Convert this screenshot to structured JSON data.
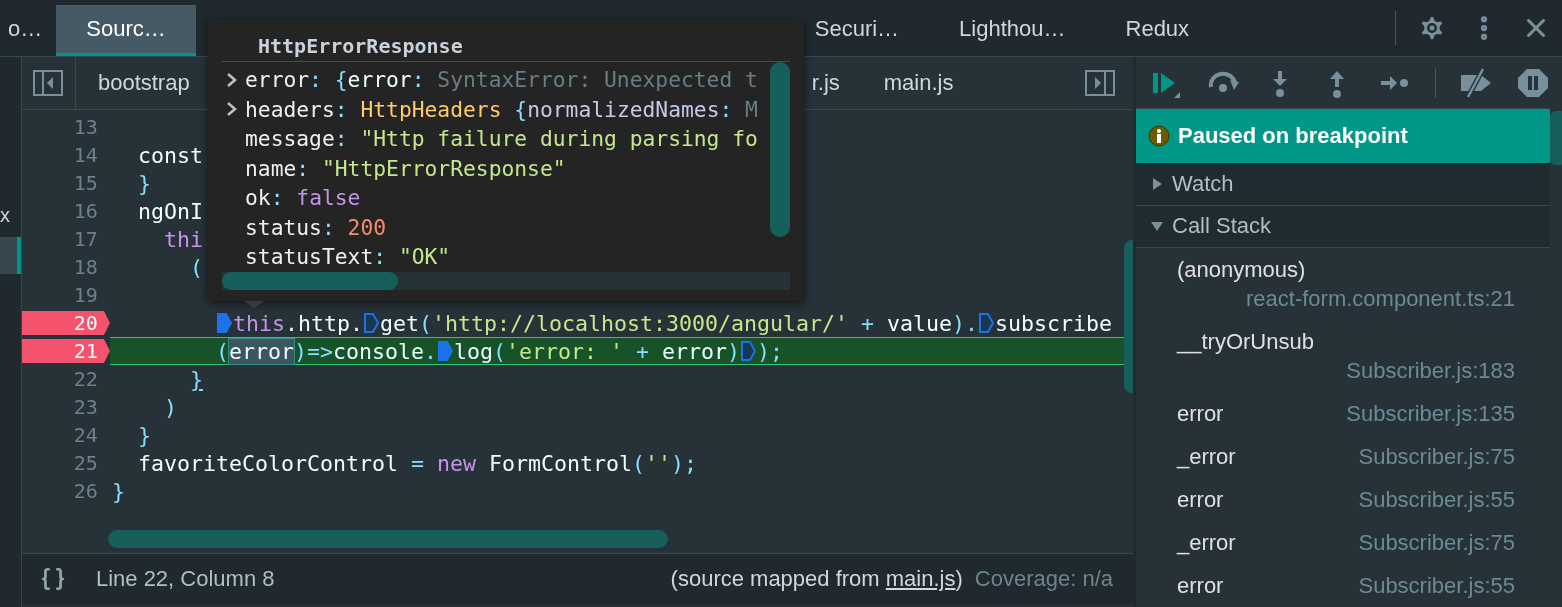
{
  "top_tabs": [
    {
      "label": "o…",
      "selected": false
    },
    {
      "label": "Sourc…",
      "selected": true
    },
    {
      "label": "Securi…",
      "selected": false
    },
    {
      "label": "Lighthou…",
      "selected": false
    },
    {
      "label": "Redux",
      "selected": false
    }
  ],
  "left_panel": {
    "items": [
      {
        "text": "x",
        "selected": false
      },
      {
        "selected": true
      }
    ]
  },
  "file_tabs": [
    {
      "label": "bootstrap"
    },
    {
      "label": "r.js"
    },
    {
      "label": "main.js"
    }
  ],
  "code_lines": [
    {
      "number": "13",
      "breakpoint": false,
      "current": false,
      "children": [
        {
          "number": "14",
          "breakpoint": false,
          "current": false,
          "tokens": [
            {
              "kind": "plain",
              "text": "const"
            }
          ]
        },
        {
          "number": "15",
          "breakpoint": false,
          "current": false,
          "tokens": [
            {
              "kind": "punct",
              "text": "}"
            }
          ]
        },
        {
          "number": "16",
          "breakpoint": false,
          "current": false,
          "tokens": [
            {
              "kind": "plain",
              "text": "ngOnI"
            }
          ],
          "children": [
            {
              "number": "17",
              "breakpoint": false,
              "current": false,
              "tokens": [
                {
                  "kind": "keyword",
                  "text": "thi"
                }
              ],
              "children": [
                {
                  "number": "18",
                  "breakpoint": false,
                  "current": false,
                  "tokens": [
                    {
                      "kind": "punct",
                      "text": "("
                    }
                  ],
                  "children": [
                    {
                      "number": "19",
                      "breakpoint": false,
                      "current": false
                    },
                    {
                      "number": "20",
                      "breakpoint": true,
                      "current": false,
                      "tokens": [
                        {
                          "kind": "marker",
                          "active": true
                        },
                        {
                          "kind": "keyword",
                          "text": "this"
                        },
                        {
                          "kind": "plain",
                          "text": ".http."
                        },
                        {
                          "kind": "marker",
                          "active": false
                        },
                        {
                          "kind": "plain",
                          "text": "get"
                        },
                        {
                          "kind": "punct",
                          "text": "("
                        },
                        {
                          "kind": "string",
                          "text": "'http://localhost:3000/angular/'"
                        },
                        {
                          "kind": "punct",
                          "text": " + "
                        },
                        {
                          "kind": "plain",
                          "text": "value"
                        },
                        {
                          "kind": "punct",
                          "text": ")."
                        },
                        {
                          "kind": "marker",
                          "active": false
                        },
                        {
                          "kind": "plain",
                          "text": "subscribe"
                        }
                      ]
                    },
                    {
                      "number": "21",
                      "breakpoint": true,
                      "current": true,
                      "tokens": [
                        {
                          "kind": "punct",
                          "text": "("
                        },
                        {
                          "kind": "hover",
                          "text": "error"
                        },
                        {
                          "kind": "punct",
                          "text": ")=>"
                        },
                        {
                          "kind": "plain",
                          "text": "console"
                        },
                        {
                          "kind": "punct",
                          "text": "."
                        },
                        {
                          "kind": "marker",
                          "active": true
                        },
                        {
                          "kind": "plain",
                          "text": "log"
                        },
                        {
                          "kind": "punct",
                          "text": "("
                        },
                        {
                          "kind": "string",
                          "text": "'error: '"
                        },
                        {
                          "kind": "punct",
                          "text": " + "
                        },
                        {
                          "kind": "plain",
                          "text": "error"
                        },
                        {
                          "kind": "punct",
                          "text": ")"
                        },
                        {
                          "kind": "marker",
                          "active": false
                        },
                        {
                          "kind": "punct",
                          "text": ");"
                        }
                      ]
                    }
                  ]
                },
                {
                  "number": "22",
                  "breakpoint": false,
                  "current": false,
                  "tokens": [
                    {
                      "kind": "match",
                      "text": "}"
                    }
                  ]
                }
              ]
            },
            {
              "number": "23",
              "breakpoint": false,
              "current": false,
              "tokens": [
                {
                  "kind": "punct",
                  "text": ")"
                }
              ]
            }
          ]
        },
        {
          "number": "24",
          "breakpoint": false,
          "current": false,
          "tokens": [
            {
              "kind": "punct",
              "text": "}"
            }
          ]
        },
        {
          "number": "25",
          "breakpoint": false,
          "current": false,
          "tokens": [
            {
              "kind": "plain",
              "text": "favoriteColorControl"
            },
            {
              "kind": "punct",
              "text": " = "
            },
            {
              "kind": "keyword",
              "text": "new"
            },
            {
              "kind": "plain",
              "text": " FormControl"
            },
            {
              "kind": "punct",
              "text": "("
            },
            {
              "kind": "string",
              "text": "''"
            },
            {
              "kind": "punct",
              "text": ");"
            }
          ]
        }
      ]
    },
    {
      "number": "26",
      "breakpoint": false,
      "current": false,
      "tokens": [
        {
          "kind": "punct",
          "text": "}"
        }
      ]
    }
  ],
  "popover": {
    "title": "HttpErrorResponse",
    "rows": [
      {
        "key": "error",
        "expandable": true,
        "parts": [
          {
            "kind": "punct",
            "text": ": {"
          },
          {
            "kind": "plain",
            "text": "error"
          },
          {
            "kind": "punct",
            "text": ": "
          },
          {
            "kind": "dim",
            "text": "SyntaxError: Unexpected t"
          }
        ]
      },
      {
        "key": "headers",
        "expandable": true,
        "parts": [
          {
            "kind": "punct",
            "text": ": "
          },
          {
            "kind": "type",
            "text": "HttpHeaders"
          },
          {
            "kind": "punct",
            "text": " {"
          },
          {
            "kind": "soft",
            "text": "normalizedNames"
          },
          {
            "kind": "punct",
            "text": ": "
          },
          {
            "kind": "dim",
            "text": "M"
          }
        ]
      },
      {
        "key": "message",
        "expandable": false,
        "parts": [
          {
            "kind": "punct",
            "text": ": "
          },
          {
            "kind": "string",
            "text": "\"Http failure during parsing fo"
          }
        ]
      },
      {
        "key": "name",
        "expandable": false,
        "parts": [
          {
            "kind": "punct",
            "text": ": "
          },
          {
            "kind": "string",
            "text": "\"HttpErrorResponse\""
          }
        ]
      },
      {
        "key": "ok",
        "expandable": false,
        "parts": [
          {
            "kind": "punct",
            "text": ": "
          },
          {
            "kind": "keyword",
            "text": "false"
          }
        ]
      },
      {
        "key": "status",
        "expandable": false,
        "parts": [
          {
            "kind": "punct",
            "text": ": "
          },
          {
            "kind": "number",
            "text": "200"
          }
        ]
      },
      {
        "key": "statusText",
        "expandable": false,
        "parts": [
          {
            "kind": "punct",
            "text": ": "
          },
          {
            "kind": "string",
            "text": "\"OK\""
          }
        ]
      }
    ]
  },
  "status_bar": {
    "position": "Line 22, Column 8",
    "source_prefix": "(source mapped from ",
    "source_link": "main.js",
    "source_suffix": ")",
    "coverage": "Coverage: n/a"
  },
  "debugger": {
    "paused_message": "Paused on breakpoint",
    "sections": [
      {
        "title": "Watch",
        "expanded": false
      },
      {
        "title": "Call Stack",
        "expanded": true
      }
    ],
    "call_stack": [
      {
        "name": "(anonymous)",
        "location": "react-form.component.ts:21"
      },
      {
        "name": "__tryOrUnsub",
        "location": "Subscriber.js:183"
      },
      {
        "name": "error",
        "location": "Subscriber.js:135"
      },
      {
        "name": "_error",
        "location": "Subscriber.js:75"
      },
      {
        "name": "error",
        "location": "Subscriber.js:55"
      },
      {
        "name": "_error",
        "location": "Subscriber.js:75"
      },
      {
        "name": "error",
        "location": "Subscriber.js:55"
      }
    ]
  }
}
